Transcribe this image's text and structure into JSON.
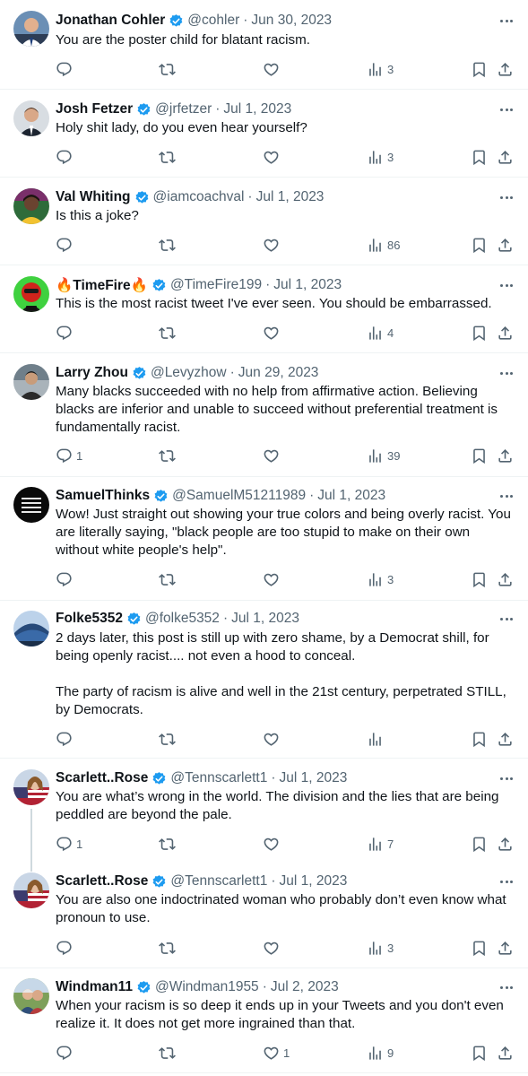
{
  "tweets": [
    {
      "name": "Jonathan Cohler",
      "handle": "@cohler",
      "date": "Jun 30, 2023",
      "lines": [
        "You are the poster child for blatant racism."
      ],
      "replies": "",
      "retweets": "",
      "likes": "",
      "views": "3"
    },
    {
      "name": "Josh Fetzer",
      "handle": "@jrfetzer",
      "date": "Jul 1, 2023",
      "lines": [
        "Holy shit lady, do you even hear yourself?"
      ],
      "replies": "",
      "retweets": "",
      "likes": "",
      "views": "3"
    },
    {
      "name": "Val Whiting",
      "handle": "@iamcoachval",
      "date": "Jul 1, 2023",
      "lines": [
        "Is this a joke?"
      ],
      "replies": "",
      "retweets": "",
      "likes": "",
      "views": "86"
    },
    {
      "name": "🔥TimeFire🔥",
      "handle": "@TimeFire199",
      "date": "Jul 1, 2023",
      "lines": [
        "This is the most racist tweet I've ever seen. You should be embarrassed."
      ],
      "replies": "",
      "retweets": "",
      "likes": "",
      "views": "4"
    },
    {
      "name": "Larry Zhou",
      "handle": "@Levyzhow",
      "date": "Jun 29, 2023",
      "lines": [
        "Many blacks succeeded with no help from affirmative action. Believing",
        "blacks are inferior and unable to succeed without preferential treatment is",
        "fundamentally racist."
      ],
      "replies": "1",
      "retweets": "",
      "likes": "",
      "views": "39"
    },
    {
      "name": "SamuelThinks",
      "handle": "@SamuelM51211989",
      "date": "Jul 1, 2023",
      "lines": [
        "Wow! Just straight out showing your true colors and being overly racist. You",
        "are literally saying, \"black people are too stupid to make on their own",
        "without white people's help\"."
      ],
      "replies": "",
      "retweets": "",
      "likes": "",
      "views": "3"
    },
    {
      "name": "Folke5352",
      "handle": "@folke5352",
      "date": "Jul 1, 2023",
      "lines": [
        "2 days later, this post is still up with zero shame, by a Democrat shill, for",
        "being openly racist.... not even a hood to conceal.",
        "",
        "The party of racism is alive and well in the 21st century, perpetrated STILL,",
        "by Democrats."
      ],
      "replies": "",
      "retweets": "",
      "likes": "",
      "views": ""
    },
    {
      "name": "Scarlett..Rose",
      "handle": "@Tennscarlett1",
      "date": "Jul 1, 2023",
      "lines": [
        "You are what’s wrong in the world.  The division and the lies that are being",
        "peddled are beyond the pale."
      ],
      "replies": "1",
      "retweets": "",
      "likes": "",
      "views": "7"
    },
    {
      "name": "Scarlett..Rose",
      "handle": "@Tennscarlett1",
      "date": "Jul 1, 2023",
      "lines": [
        "You are also one indoctrinated woman who probably don’t even know what",
        "pronoun to use."
      ],
      "replies": "",
      "retweets": "",
      "likes": "",
      "views": "3"
    },
    {
      "name": "Windman11",
      "handle": "@Windman1955",
      "date": "Jul 2, 2023",
      "lines": [
        "When your racism is so deep it ends up in your Tweets and you don't even",
        "realize it.  It does not get more ingrained than that."
      ],
      "replies": "",
      "retweets": "",
      "likes": "1",
      "views": "9"
    }
  ],
  "colors": {
    "verified": "#1d9bf0",
    "secondary_text": "#536471",
    "divider": "#eff3f4",
    "thread_line": "#cfd9de"
  },
  "icons": [
    "reply-icon",
    "retweet-icon",
    "like-icon",
    "views-icon",
    "bookmark-icon",
    "share-icon",
    "verified-badge-icon",
    "more-icon"
  ]
}
